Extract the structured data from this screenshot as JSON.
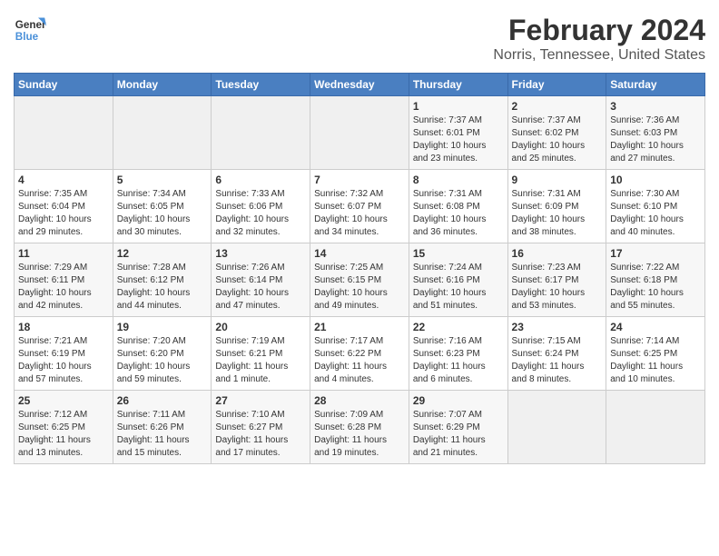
{
  "header": {
    "logo_line1": "General",
    "logo_line2": "Blue",
    "title": "February 2024",
    "subtitle": "Norris, Tennessee, United States"
  },
  "weekdays": [
    "Sunday",
    "Monday",
    "Tuesday",
    "Wednesday",
    "Thursday",
    "Friday",
    "Saturday"
  ],
  "weeks": [
    [
      {
        "day": "",
        "info": ""
      },
      {
        "day": "",
        "info": ""
      },
      {
        "day": "",
        "info": ""
      },
      {
        "day": "",
        "info": ""
      },
      {
        "day": "1",
        "info": "Sunrise: 7:37 AM\nSunset: 6:01 PM\nDaylight: 10 hours\nand 23 minutes."
      },
      {
        "day": "2",
        "info": "Sunrise: 7:37 AM\nSunset: 6:02 PM\nDaylight: 10 hours\nand 25 minutes."
      },
      {
        "day": "3",
        "info": "Sunrise: 7:36 AM\nSunset: 6:03 PM\nDaylight: 10 hours\nand 27 minutes."
      }
    ],
    [
      {
        "day": "4",
        "info": "Sunrise: 7:35 AM\nSunset: 6:04 PM\nDaylight: 10 hours\nand 29 minutes."
      },
      {
        "day": "5",
        "info": "Sunrise: 7:34 AM\nSunset: 6:05 PM\nDaylight: 10 hours\nand 30 minutes."
      },
      {
        "day": "6",
        "info": "Sunrise: 7:33 AM\nSunset: 6:06 PM\nDaylight: 10 hours\nand 32 minutes."
      },
      {
        "day": "7",
        "info": "Sunrise: 7:32 AM\nSunset: 6:07 PM\nDaylight: 10 hours\nand 34 minutes."
      },
      {
        "day": "8",
        "info": "Sunrise: 7:31 AM\nSunset: 6:08 PM\nDaylight: 10 hours\nand 36 minutes."
      },
      {
        "day": "9",
        "info": "Sunrise: 7:31 AM\nSunset: 6:09 PM\nDaylight: 10 hours\nand 38 minutes."
      },
      {
        "day": "10",
        "info": "Sunrise: 7:30 AM\nSunset: 6:10 PM\nDaylight: 10 hours\nand 40 minutes."
      }
    ],
    [
      {
        "day": "11",
        "info": "Sunrise: 7:29 AM\nSunset: 6:11 PM\nDaylight: 10 hours\nand 42 minutes."
      },
      {
        "day": "12",
        "info": "Sunrise: 7:28 AM\nSunset: 6:12 PM\nDaylight: 10 hours\nand 44 minutes."
      },
      {
        "day": "13",
        "info": "Sunrise: 7:26 AM\nSunset: 6:14 PM\nDaylight: 10 hours\nand 47 minutes."
      },
      {
        "day": "14",
        "info": "Sunrise: 7:25 AM\nSunset: 6:15 PM\nDaylight: 10 hours\nand 49 minutes."
      },
      {
        "day": "15",
        "info": "Sunrise: 7:24 AM\nSunset: 6:16 PM\nDaylight: 10 hours\nand 51 minutes."
      },
      {
        "day": "16",
        "info": "Sunrise: 7:23 AM\nSunset: 6:17 PM\nDaylight: 10 hours\nand 53 minutes."
      },
      {
        "day": "17",
        "info": "Sunrise: 7:22 AM\nSunset: 6:18 PM\nDaylight: 10 hours\nand 55 minutes."
      }
    ],
    [
      {
        "day": "18",
        "info": "Sunrise: 7:21 AM\nSunset: 6:19 PM\nDaylight: 10 hours\nand 57 minutes."
      },
      {
        "day": "19",
        "info": "Sunrise: 7:20 AM\nSunset: 6:20 PM\nDaylight: 10 hours\nand 59 minutes."
      },
      {
        "day": "20",
        "info": "Sunrise: 7:19 AM\nSunset: 6:21 PM\nDaylight: 11 hours\nand 1 minute."
      },
      {
        "day": "21",
        "info": "Sunrise: 7:17 AM\nSunset: 6:22 PM\nDaylight: 11 hours\nand 4 minutes."
      },
      {
        "day": "22",
        "info": "Sunrise: 7:16 AM\nSunset: 6:23 PM\nDaylight: 11 hours\nand 6 minutes."
      },
      {
        "day": "23",
        "info": "Sunrise: 7:15 AM\nSunset: 6:24 PM\nDaylight: 11 hours\nand 8 minutes."
      },
      {
        "day": "24",
        "info": "Sunrise: 7:14 AM\nSunset: 6:25 PM\nDaylight: 11 hours\nand 10 minutes."
      }
    ],
    [
      {
        "day": "25",
        "info": "Sunrise: 7:12 AM\nSunset: 6:25 PM\nDaylight: 11 hours\nand 13 minutes."
      },
      {
        "day": "26",
        "info": "Sunrise: 7:11 AM\nSunset: 6:26 PM\nDaylight: 11 hours\nand 15 minutes."
      },
      {
        "day": "27",
        "info": "Sunrise: 7:10 AM\nSunset: 6:27 PM\nDaylight: 11 hours\nand 17 minutes."
      },
      {
        "day": "28",
        "info": "Sunrise: 7:09 AM\nSunset: 6:28 PM\nDaylight: 11 hours\nand 19 minutes."
      },
      {
        "day": "29",
        "info": "Sunrise: 7:07 AM\nSunset: 6:29 PM\nDaylight: 11 hours\nand 21 minutes."
      },
      {
        "day": "",
        "info": ""
      },
      {
        "day": "",
        "info": ""
      }
    ]
  ]
}
